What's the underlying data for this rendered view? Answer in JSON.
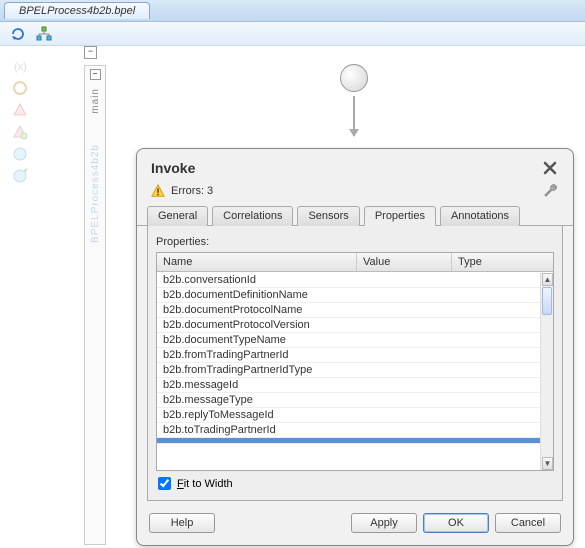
{
  "topTab": {
    "label": "BPELProcess4b2b.bpel"
  },
  "lane": {
    "mainLabel": "main",
    "fadedLabel": "BPELProcess4b2b"
  },
  "dialog": {
    "title": "Invoke",
    "errors_label": "Errors: 3",
    "tabs": {
      "general": "General",
      "correlations": "Correlations",
      "sensors": "Sensors",
      "properties": "Properties",
      "annotations": "Annotations"
    },
    "props_label": "Properties:",
    "columns": {
      "name": "Name",
      "value": "Value",
      "type": "Type"
    },
    "rows": [
      {
        "name": "b2b.conversationId",
        "value": "",
        "type": ""
      },
      {
        "name": "b2b.documentDefinitionName",
        "value": "",
        "type": ""
      },
      {
        "name": "b2b.documentProtocolName",
        "value": "",
        "type": ""
      },
      {
        "name": "b2b.documentProtocolVersion",
        "value": "",
        "type": ""
      },
      {
        "name": "b2b.documentTypeName",
        "value": "",
        "type": ""
      },
      {
        "name": "b2b.fromTradingPartnerId",
        "value": "",
        "type": ""
      },
      {
        "name": "b2b.fromTradingPartnerIdType",
        "value": "",
        "type": ""
      },
      {
        "name": "b2b.messageId",
        "value": "",
        "type": ""
      },
      {
        "name": "b2b.messageType",
        "value": "",
        "type": ""
      },
      {
        "name": "b2b.replyToMessageId",
        "value": "",
        "type": ""
      },
      {
        "name": "b2b.toTradingPartnerId",
        "value": "",
        "type": ""
      }
    ],
    "fit_label_pre": "F",
    "fit_label_post": "it to Width",
    "buttons": {
      "help": "Help",
      "apply": "Apply",
      "ok": "OK",
      "cancel": "Cancel"
    }
  }
}
